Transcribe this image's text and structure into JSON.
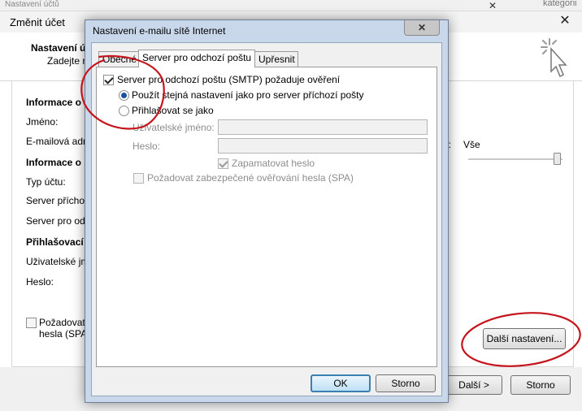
{
  "background_window": {
    "top_strip_text": "Nastavení účtů",
    "top_strip_close": "✕",
    "top_strip_right_text": "kategorii",
    "title": "Změnit účet",
    "close_glyph": "✕",
    "header_title": "Nastavení ú",
    "header_subtitle": "Zadejte n",
    "sections": {
      "user_info": "Informace o u",
      "server_info": "Informace o s",
      "login_info": "Přihlašovací in"
    },
    "labels": {
      "name": "Jméno:",
      "email": "E-mailová adre",
      "account_type": "Typ účtu:",
      "incoming_server": "Server příchoz",
      "outgoing_server": "Server pro odc",
      "username": "Uživatelské jm",
      "password": "Heslo:"
    },
    "mail_offline": {
      "label": "e:",
      "value": "Vše"
    },
    "spa_option": {
      "line1": "Požadovat",
      "line2": "hesla (SPA)",
      "checked": false
    },
    "more_settings_button": "Další nastavení...",
    "next_button": "Další >",
    "cancel_button": "Storno"
  },
  "dialog": {
    "title": "Nastavení e-mailu sítě Internet",
    "close_glyph": "✕",
    "tabs": [
      {
        "label": "Obecné",
        "active": false
      },
      {
        "label": "Server pro odchozí poštu",
        "active": true
      },
      {
        "label": "Upřesnit",
        "active": false
      }
    ],
    "smtp_auth": {
      "label": "Server pro odchozí poštu (SMTP) požaduje ověření",
      "checked": true
    },
    "radio_same_settings": {
      "label": "Použít stejná nastavení jako pro server příchozí pošty",
      "selected": true
    },
    "radio_login": {
      "label": "Přihlašovat se jako",
      "selected": false
    },
    "username_label": "Uživatelské jméno:",
    "username_value": "",
    "password_label": "Heslo:",
    "password_value": "",
    "remember_password": {
      "label": "Zapamatovat heslo",
      "checked": true,
      "disabled": true
    },
    "secure_password_auth": {
      "label": "Požadovat zabezpečené ověřování hesla (SPA)",
      "checked": false,
      "disabled": true
    },
    "ok_button": "OK",
    "cancel_button": "Storno"
  },
  "colors": {
    "annotation_red": "#c4141c",
    "dialog_frame": "#c8d7ea",
    "default_button_border": "#3c7fb1"
  }
}
